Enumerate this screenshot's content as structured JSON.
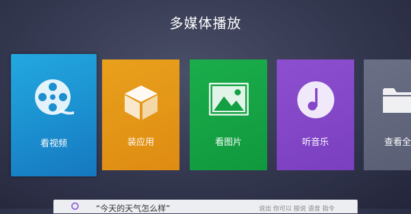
{
  "page": {
    "title": "多媒体播放"
  },
  "tiles": [
    {
      "label": "看视频",
      "icon": "film-reel-icon",
      "color": "#1b8fcf"
    },
    {
      "label": "装应用",
      "icon": "box-icon",
      "color": "#e3941a"
    },
    {
      "label": "看图片",
      "icon": "picture-icon",
      "color": "#15a343"
    },
    {
      "label": "听音乐",
      "icon": "music-note-icon",
      "color": "#8547c8"
    },
    {
      "label": "查看全",
      "icon": "folder-icon",
      "color": "#62677e"
    }
  ],
  "voice_bar": {
    "query": "“今天的天气怎么样”",
    "hint": "说出 你可以 按说 语音 指令"
  }
}
